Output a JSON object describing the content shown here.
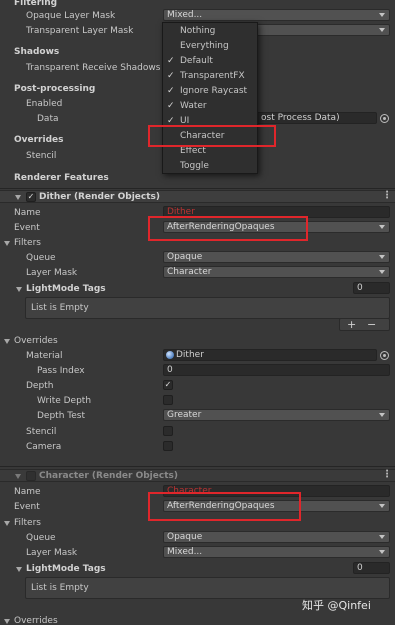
{
  "section1": {
    "filtering_label": "Filtering",
    "opaque_layer_mask_label": "Opaque Layer Mask",
    "opaque_layer_mask_value": "Mixed...",
    "transparent_layer_mask_label": "Transparent Layer Mask",
    "shadows_label": "Shadows",
    "transparent_receive_shadows_label": "Transparent Receive Shadows",
    "post_processing_label": "Post-processing",
    "enabled_label": "Enabled",
    "data_label": "Data",
    "data_value": "ost Process Data)",
    "overrides_label": "Overrides",
    "stencil_label": "Stencil",
    "renderer_features_label": "Renderer Features"
  },
  "layer_popup": {
    "items": [
      {
        "check": "",
        "label": "Nothing"
      },
      {
        "check": "",
        "label": "Everything"
      },
      {
        "check": "✓",
        "label": "Default"
      },
      {
        "check": "✓",
        "label": "TransparentFX"
      },
      {
        "check": "✓",
        "label": "Ignore Raycast"
      },
      {
        "check": "✓",
        "label": "Water"
      },
      {
        "check": "✓",
        "label": "UI"
      },
      {
        "check": "",
        "label": "Character"
      },
      {
        "check": "",
        "label": "Effect"
      },
      {
        "check": "",
        "label": "Toggle"
      }
    ]
  },
  "dither": {
    "header_title": "Dither (Render Objects)",
    "enabled_check": "✓",
    "name_label": "Name",
    "name_value": "Dither",
    "event_label": "Event",
    "event_value": "AfterRenderingOpaques",
    "filters_label": "Filters",
    "queue_label": "Queue",
    "queue_value": "Opaque",
    "layer_mask_label": "Layer Mask",
    "layer_mask_value": "Character",
    "lightmode_tags_label": "LightMode Tags",
    "lightmode_tags_count": "0",
    "list_empty": "List is Empty",
    "add_symbol": "+",
    "remove_symbol": "−",
    "overrides_label": "Overrides",
    "material_label": "Material",
    "material_value": "Dither",
    "pass_index_label": "Pass Index",
    "pass_index_value": "0",
    "depth_label": "Depth",
    "depth_check": "✓",
    "write_depth_label": "Write Depth",
    "depth_test_label": "Depth Test",
    "depth_test_value": "Greater",
    "stencil_label": "Stencil",
    "camera_label": "Camera"
  },
  "character": {
    "header_title": "Character (Render Objects)",
    "name_label": "Name",
    "name_value": "Character",
    "event_label": "Event",
    "event_value": "AfterRenderingOpaques",
    "filters_label": "Filters",
    "queue_label": "Queue",
    "queue_value": "Opaque",
    "layer_mask_label": "Layer Mask",
    "layer_mask_value": "Mixed...",
    "lightmode_tags_label": "LightMode Tags",
    "lightmode_tags_count": "0",
    "list_empty": "List is Empty",
    "overrides_label": "Overrides"
  },
  "watermark": {
    "text": "知乎 @Qinfei"
  },
  "colors": {
    "background": "#383838",
    "highlight_box": "#e0262b",
    "field_bg": "#2a2a2a",
    "dropdown_bg": "#515151"
  }
}
